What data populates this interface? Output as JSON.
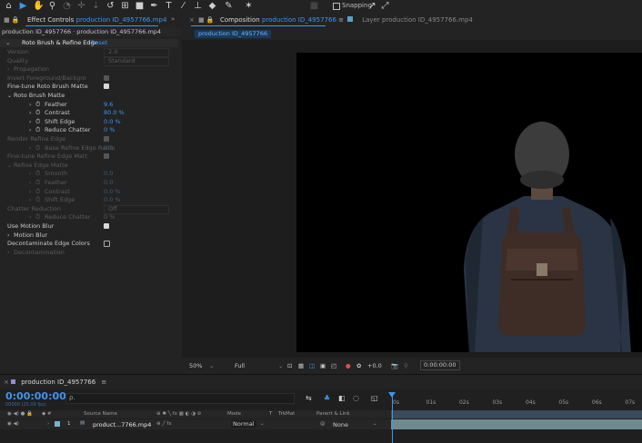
{
  "toolbar": {
    "icons": [
      "home-icon",
      "selection-arrow-icon",
      "hand-icon",
      "zoom-icon",
      "orbit-icon",
      "pan-icon",
      "dolly-icon",
      "rotate-icon",
      "pan-behind-icon",
      "rectangle-icon",
      "pen-icon",
      "type-icon",
      "brush-icon",
      "clone-stamp-icon",
      "eraser-icon",
      "roto-brush-icon",
      "puppet-pin-icon"
    ],
    "snapping_label": "Snapping"
  },
  "effect_controls": {
    "tab_label": "Effect Controls",
    "tab_file": "production ID_4957766.mp4",
    "header": "production ID_4957766 · production ID_4957766.mp4",
    "effect_name": "Roto Brush & Refine Edge",
    "reset_label": "Reset",
    "rows": [
      {
        "label": "Version",
        "value": "2.0",
        "state": "dim",
        "type": "select"
      },
      {
        "label": "Quality",
        "value": "Standard",
        "state": "dim",
        "type": "select"
      },
      {
        "label": "Propagation",
        "state": "dim",
        "type": "group"
      },
      {
        "label": "Invert Foreground/Backgro",
        "state": "dim",
        "type": "check"
      },
      {
        "label": "Fine-tune Roto Brush Matte",
        "state": "on",
        "type": "check"
      },
      {
        "label": "Roto Brush Matte",
        "state": "normal",
        "type": "group-open"
      },
      {
        "label": "Feather",
        "value": "9.6",
        "state": "normal",
        "type": "param"
      },
      {
        "label": "Contrast",
        "value": "80.0 %",
        "state": "normal",
        "type": "param"
      },
      {
        "label": "Shift Edge",
        "value": "0.0 %",
        "state": "normal",
        "type": "param"
      },
      {
        "label": "Reduce Chatter",
        "value": "0 %",
        "state": "normal",
        "type": "param"
      },
      {
        "label": "Render Refine Edge",
        "state": "dim",
        "type": "check"
      },
      {
        "label": "Base Refine Edge Radiu",
        "value": "0.0",
        "state": "dim",
        "type": "param"
      },
      {
        "label": "Fine-tune Refine Edge Matt",
        "state": "dim",
        "type": "check"
      },
      {
        "label": "Refine Edge Matte",
        "state": "dim",
        "type": "group-open"
      },
      {
        "label": "Smooth",
        "value": "0.0",
        "state": "dim",
        "type": "param"
      },
      {
        "label": "Feather",
        "value": "0.0",
        "state": "dim",
        "type": "param"
      },
      {
        "label": "Contrast",
        "value": "0.0 %",
        "state": "dim",
        "type": "param"
      },
      {
        "label": "Shift Edge",
        "value": "0.0 %",
        "state": "dim",
        "type": "param"
      },
      {
        "label": "Chatter Reduction",
        "value": "Off",
        "state": "dim",
        "type": "select"
      },
      {
        "label": "Reduce Chatter",
        "value": "0 %",
        "state": "dim",
        "type": "param"
      },
      {
        "label": "Use Motion Blur",
        "state": "on",
        "type": "check"
      },
      {
        "label": "Motion Blur",
        "state": "normal",
        "type": "group"
      },
      {
        "label": "Decontaminate Edge Colors",
        "state": "off",
        "type": "check"
      },
      {
        "label": "Decontamination",
        "state": "dim",
        "type": "group"
      }
    ]
  },
  "composition": {
    "tab_label": "Composition",
    "tab_name": "production ID_4957766",
    "layer_tab": "Layer  production ID_4957766.mp4",
    "chip": "production ID_4957766",
    "zoom": "50%",
    "resolution": "Full",
    "exposure": "+0.0",
    "timecode": "0:00:00:00"
  },
  "timeline": {
    "tab_label": "production ID_4957766",
    "current_time": "0:00:00:00",
    "frames_info": "00000 (25.00 fps)",
    "search_placeholder": "",
    "columns": {
      "source_name": "Source Name",
      "mode": "Mode",
      "t": "T",
      "trkmat": "TrkMat",
      "parent": "Parent & Link"
    },
    "layer": {
      "index": "1",
      "name": "product...7766.mp4",
      "mode": "Normal",
      "parent": "None"
    },
    "ticks": [
      "0s",
      "01s",
      "02s",
      "03s",
      "04s",
      "05s",
      "06s",
      "07s"
    ]
  },
  "colors": {
    "accent": "#3f95f0",
    "panel": "#232323",
    "layer_bar": "#6f8a8f"
  }
}
